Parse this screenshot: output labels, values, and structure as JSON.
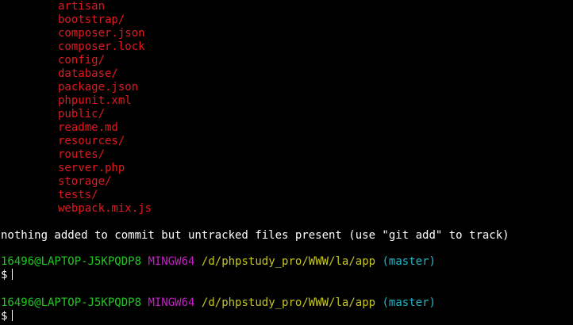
{
  "untracked_files": [
    "artisan",
    "bootstrap/",
    "composer.json",
    "composer.lock",
    "config/",
    "database/",
    "package.json",
    "phpunit.xml",
    "public/",
    "readme.md",
    "resources/",
    "routes/",
    "server.php",
    "storage/",
    "tests/",
    "webpack.mix.js"
  ],
  "status_message": "nothing added to commit but untracked files present (use \"git add\" to track)",
  "prompts": [
    {
      "user_host": "16496@LAPTOP-J5KPQDP8",
      "system": "MINGW64",
      "path": "/d/phpstudy_pro/WWW/la/app",
      "branch": "(master)",
      "symbol": "$"
    },
    {
      "user_host": "16496@LAPTOP-J5KPQDP8",
      "system": "MINGW64",
      "path": "/d/phpstudy_pro/WWW/la/app",
      "branch": "(master)",
      "symbol": "$"
    }
  ],
  "colors": {
    "background": "#000000",
    "untracked_file": "#e0191f",
    "user_host": "#1fc91f",
    "system": "#c61fc6",
    "path": "#c6c61f",
    "branch": "#1fb8c9",
    "text": "#ffffff"
  }
}
